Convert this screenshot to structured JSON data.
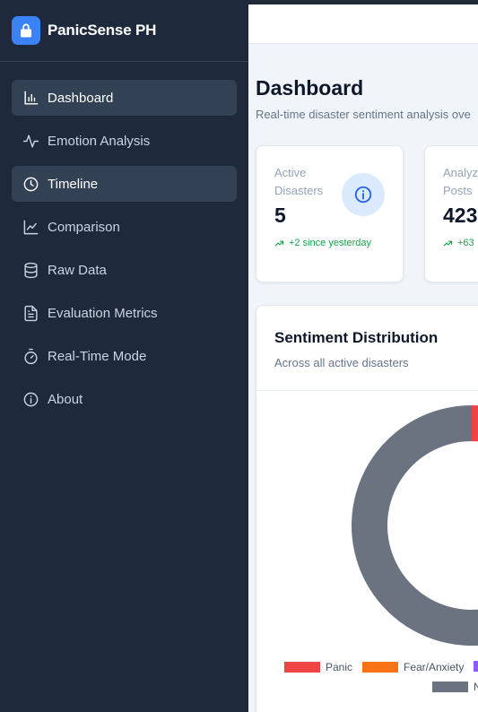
{
  "app": {
    "name": "PanicSense PH"
  },
  "sidebar": {
    "items": [
      {
        "label": "Dashboard",
        "icon": "bar-chart-icon",
        "active": true
      },
      {
        "label": "Emotion Analysis",
        "icon": "activity-icon",
        "active": false
      },
      {
        "label": "Timeline",
        "icon": "clock-icon",
        "active": true
      },
      {
        "label": "Comparison",
        "icon": "line-chart-icon",
        "active": false
      },
      {
        "label": "Raw Data",
        "icon": "database-icon",
        "active": false
      },
      {
        "label": "Evaluation Metrics",
        "icon": "file-text-icon",
        "active": false
      },
      {
        "label": "Real-Time Mode",
        "icon": "timer-icon",
        "active": false
      },
      {
        "label": "About",
        "icon": "info-icon",
        "active": false
      }
    ]
  },
  "main": {
    "title": "Dashboard",
    "subtitle": "Real-time disaster sentiment analysis ove",
    "stats": [
      {
        "label": "Active Disasters",
        "value": "5",
        "delta": "+2 since yesterday",
        "icon": "info-icon"
      },
      {
        "label": "Analyz Posts",
        "value": "423",
        "delta": "+63"
      }
    ]
  },
  "distribution": {
    "title": "Sentiment Distribution",
    "subtitle": "Across all active disasters"
  },
  "chart_data": {
    "type": "pie",
    "title": "Sentiment Distribution",
    "legend": [
      {
        "name": "Panic",
        "color": "#ef4444"
      },
      {
        "name": "Fear/Anxiety",
        "color": "#f97316"
      },
      {
        "name": "",
        "color": "#8b5cf6"
      },
      {
        "name": "N",
        "color": "#6b7280"
      }
    ],
    "slices": [
      {
        "name": "Panic",
        "value": 2,
        "color": "#ef4444"
      },
      {
        "name": "N",
        "value": 98,
        "color": "#6b7280"
      }
    ]
  },
  "colors": {
    "accent": "#3b82f6",
    "sidebar_bg": "#1e293b",
    "positive": "#16a34a"
  }
}
